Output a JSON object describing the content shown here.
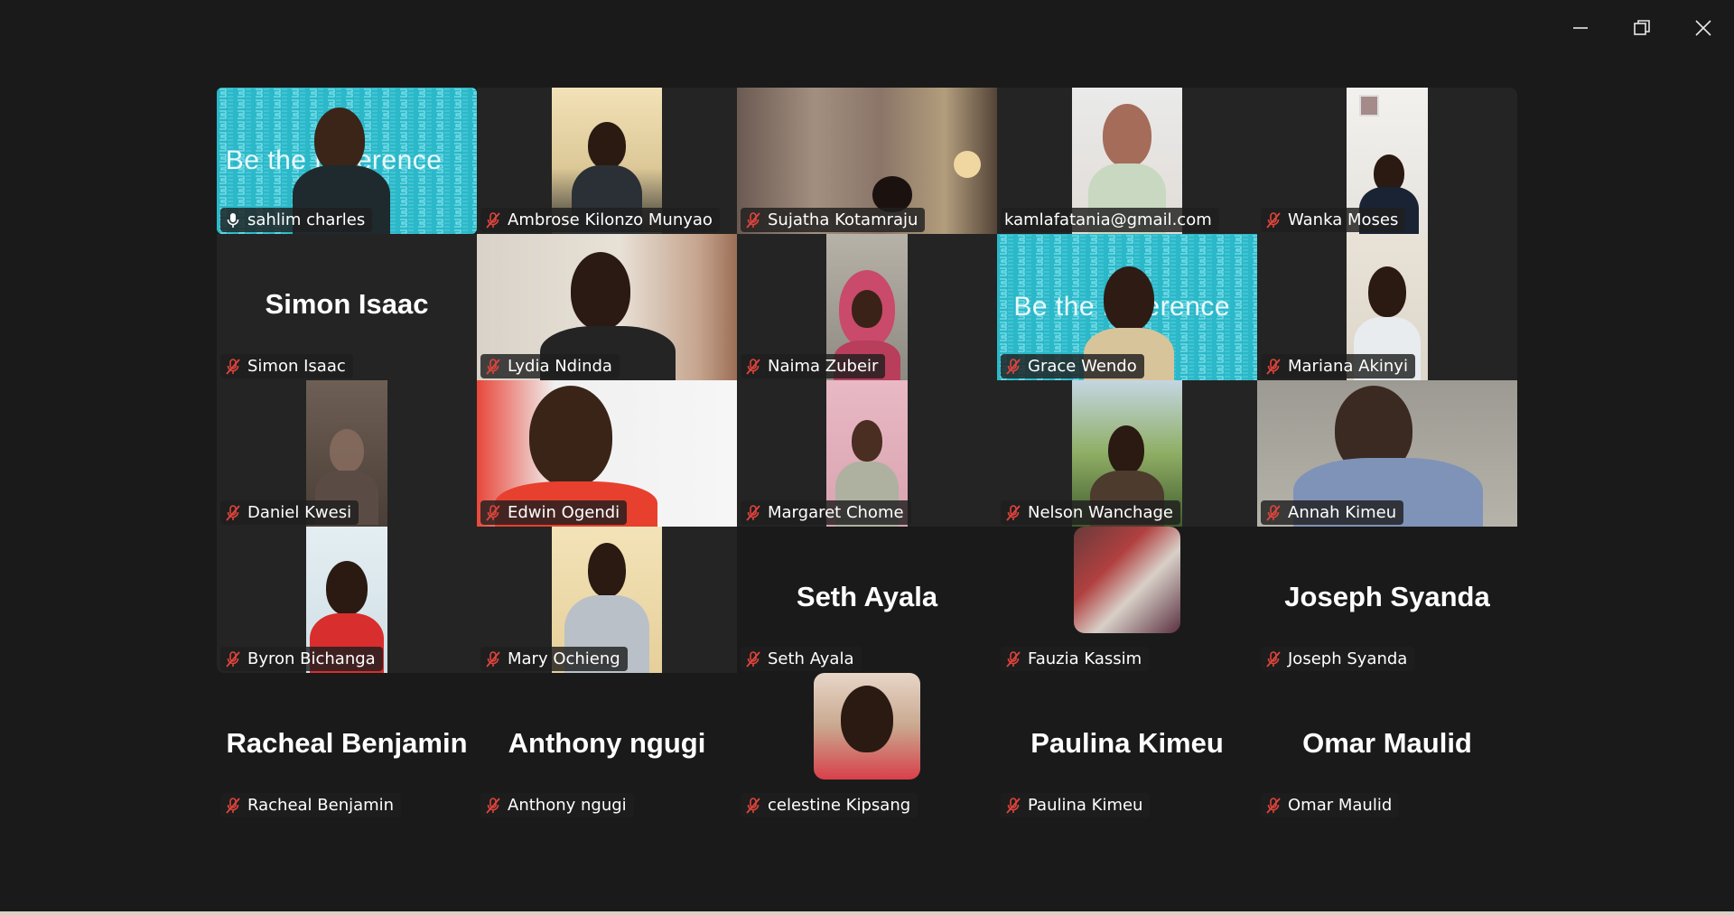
{
  "window_controls": [
    "minimize",
    "restore",
    "close"
  ],
  "colors": {
    "active_border": "#23d18b",
    "muted_mic": "#e0443c",
    "background": "#1a1a1a",
    "tile": "#242424"
  },
  "background_text": "Be the Difference",
  "participants": [
    {
      "name": "sahlim charles",
      "display_name": "sahlim charles",
      "mic": "unmuted",
      "active": true
    },
    {
      "name": "Ambrose Kilonzo Munyao",
      "display_name": "Ambrose Kilonzo Munyao",
      "mic": "muted"
    },
    {
      "name": "Sujatha Kotamraju",
      "display_name": "Sujatha Kotamraju",
      "mic": "muted"
    },
    {
      "name": "kamlafatania@gmail.com",
      "display_name": "kamlafatania@gmail.com",
      "mic": "none"
    },
    {
      "name": "Wanka Moses",
      "display_name": "Wanka Moses",
      "mic": "muted"
    },
    {
      "name": "Simon Isaac",
      "display_name": "Simon Isaac",
      "mic": "muted"
    },
    {
      "name": "Lydia Ndinda",
      "display_name": "Lydia Ndinda",
      "mic": "muted"
    },
    {
      "name": "Naima Zubeir",
      "display_name": "Naima Zubeir",
      "mic": "muted"
    },
    {
      "name": "Grace Wendo",
      "display_name": "Grace Wendo",
      "mic": "muted"
    },
    {
      "name": "Mariana Akinyi",
      "display_name": "Mariana Akinyi",
      "mic": "muted"
    },
    {
      "name": "Daniel Kwesi",
      "display_name": "Daniel Kwesi",
      "mic": "muted"
    },
    {
      "name": "Edwin Ogendi",
      "display_name": "Edwin Ogendi",
      "mic": "muted"
    },
    {
      "name": "Margaret Chome",
      "display_name": "Margaret Chome",
      "mic": "muted"
    },
    {
      "name": "Nelson Wanchage",
      "display_name": "Nelson Wanchage",
      "mic": "muted"
    },
    {
      "name": "Annah Kimeu",
      "display_name": "Annah Kimeu",
      "mic": "muted"
    },
    {
      "name": "Byron Bichanga",
      "display_name": "Byron Bichanga",
      "mic": "muted"
    },
    {
      "name": "Mary Ochieng",
      "display_name": "Mary Ochieng",
      "mic": "muted"
    },
    {
      "name": "Seth Ayala",
      "display_name": "Seth Ayala",
      "mic": "muted"
    },
    {
      "name": "Fauzia Kassim",
      "display_name": "Fauzia Kassim",
      "mic": "muted"
    },
    {
      "name": "Joseph Syanda",
      "display_name": "Joseph Syanda",
      "mic": "muted"
    },
    {
      "name": "Racheal Benjamin",
      "display_name": "Racheal Benjamin",
      "mic": "muted"
    },
    {
      "name": "Anthony ngugi",
      "display_name": "Anthony ngugi",
      "mic": "muted"
    },
    {
      "name": "celestine Kipsang",
      "display_name": "celestine Kipsang",
      "mic": "muted"
    },
    {
      "name": "Paulina Kimeu",
      "display_name": "Paulina Kimeu",
      "mic": "muted"
    },
    {
      "name": "Omar Maulid",
      "display_name": "Omar Maulid",
      "mic": "muted"
    }
  ]
}
